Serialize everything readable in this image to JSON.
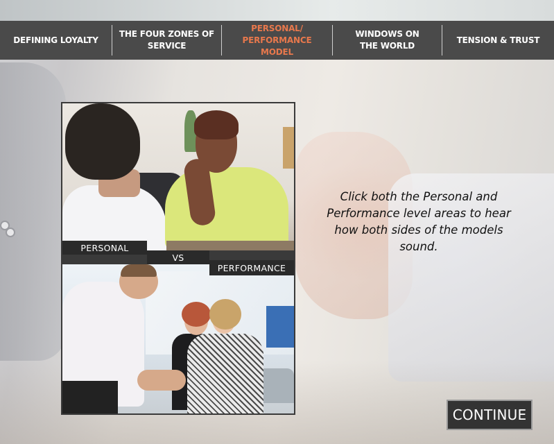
{
  "nav": {
    "items": [
      {
        "label": "DEFINING LOYALTY",
        "active": false
      },
      {
        "label": "THE FOUR ZONES OF\nSERVICE",
        "active": false
      },
      {
        "label": "PERSONAL/\nPERFORMANCE MODEL",
        "active": true
      },
      {
        "label": "WINDOWS ON\nTHE WORLD",
        "active": false
      },
      {
        "label": "TENSION & TRUST",
        "active": false
      }
    ],
    "active_color": "#e8784c"
  },
  "panel": {
    "personal_label": "PERSONAL",
    "vs_label": "VS",
    "performance_label": "PERFORMANCE"
  },
  "instructions": "Click both the Personal and Performance level areas to hear how both sides of the models sound.",
  "continue_label": "CONTINUE"
}
